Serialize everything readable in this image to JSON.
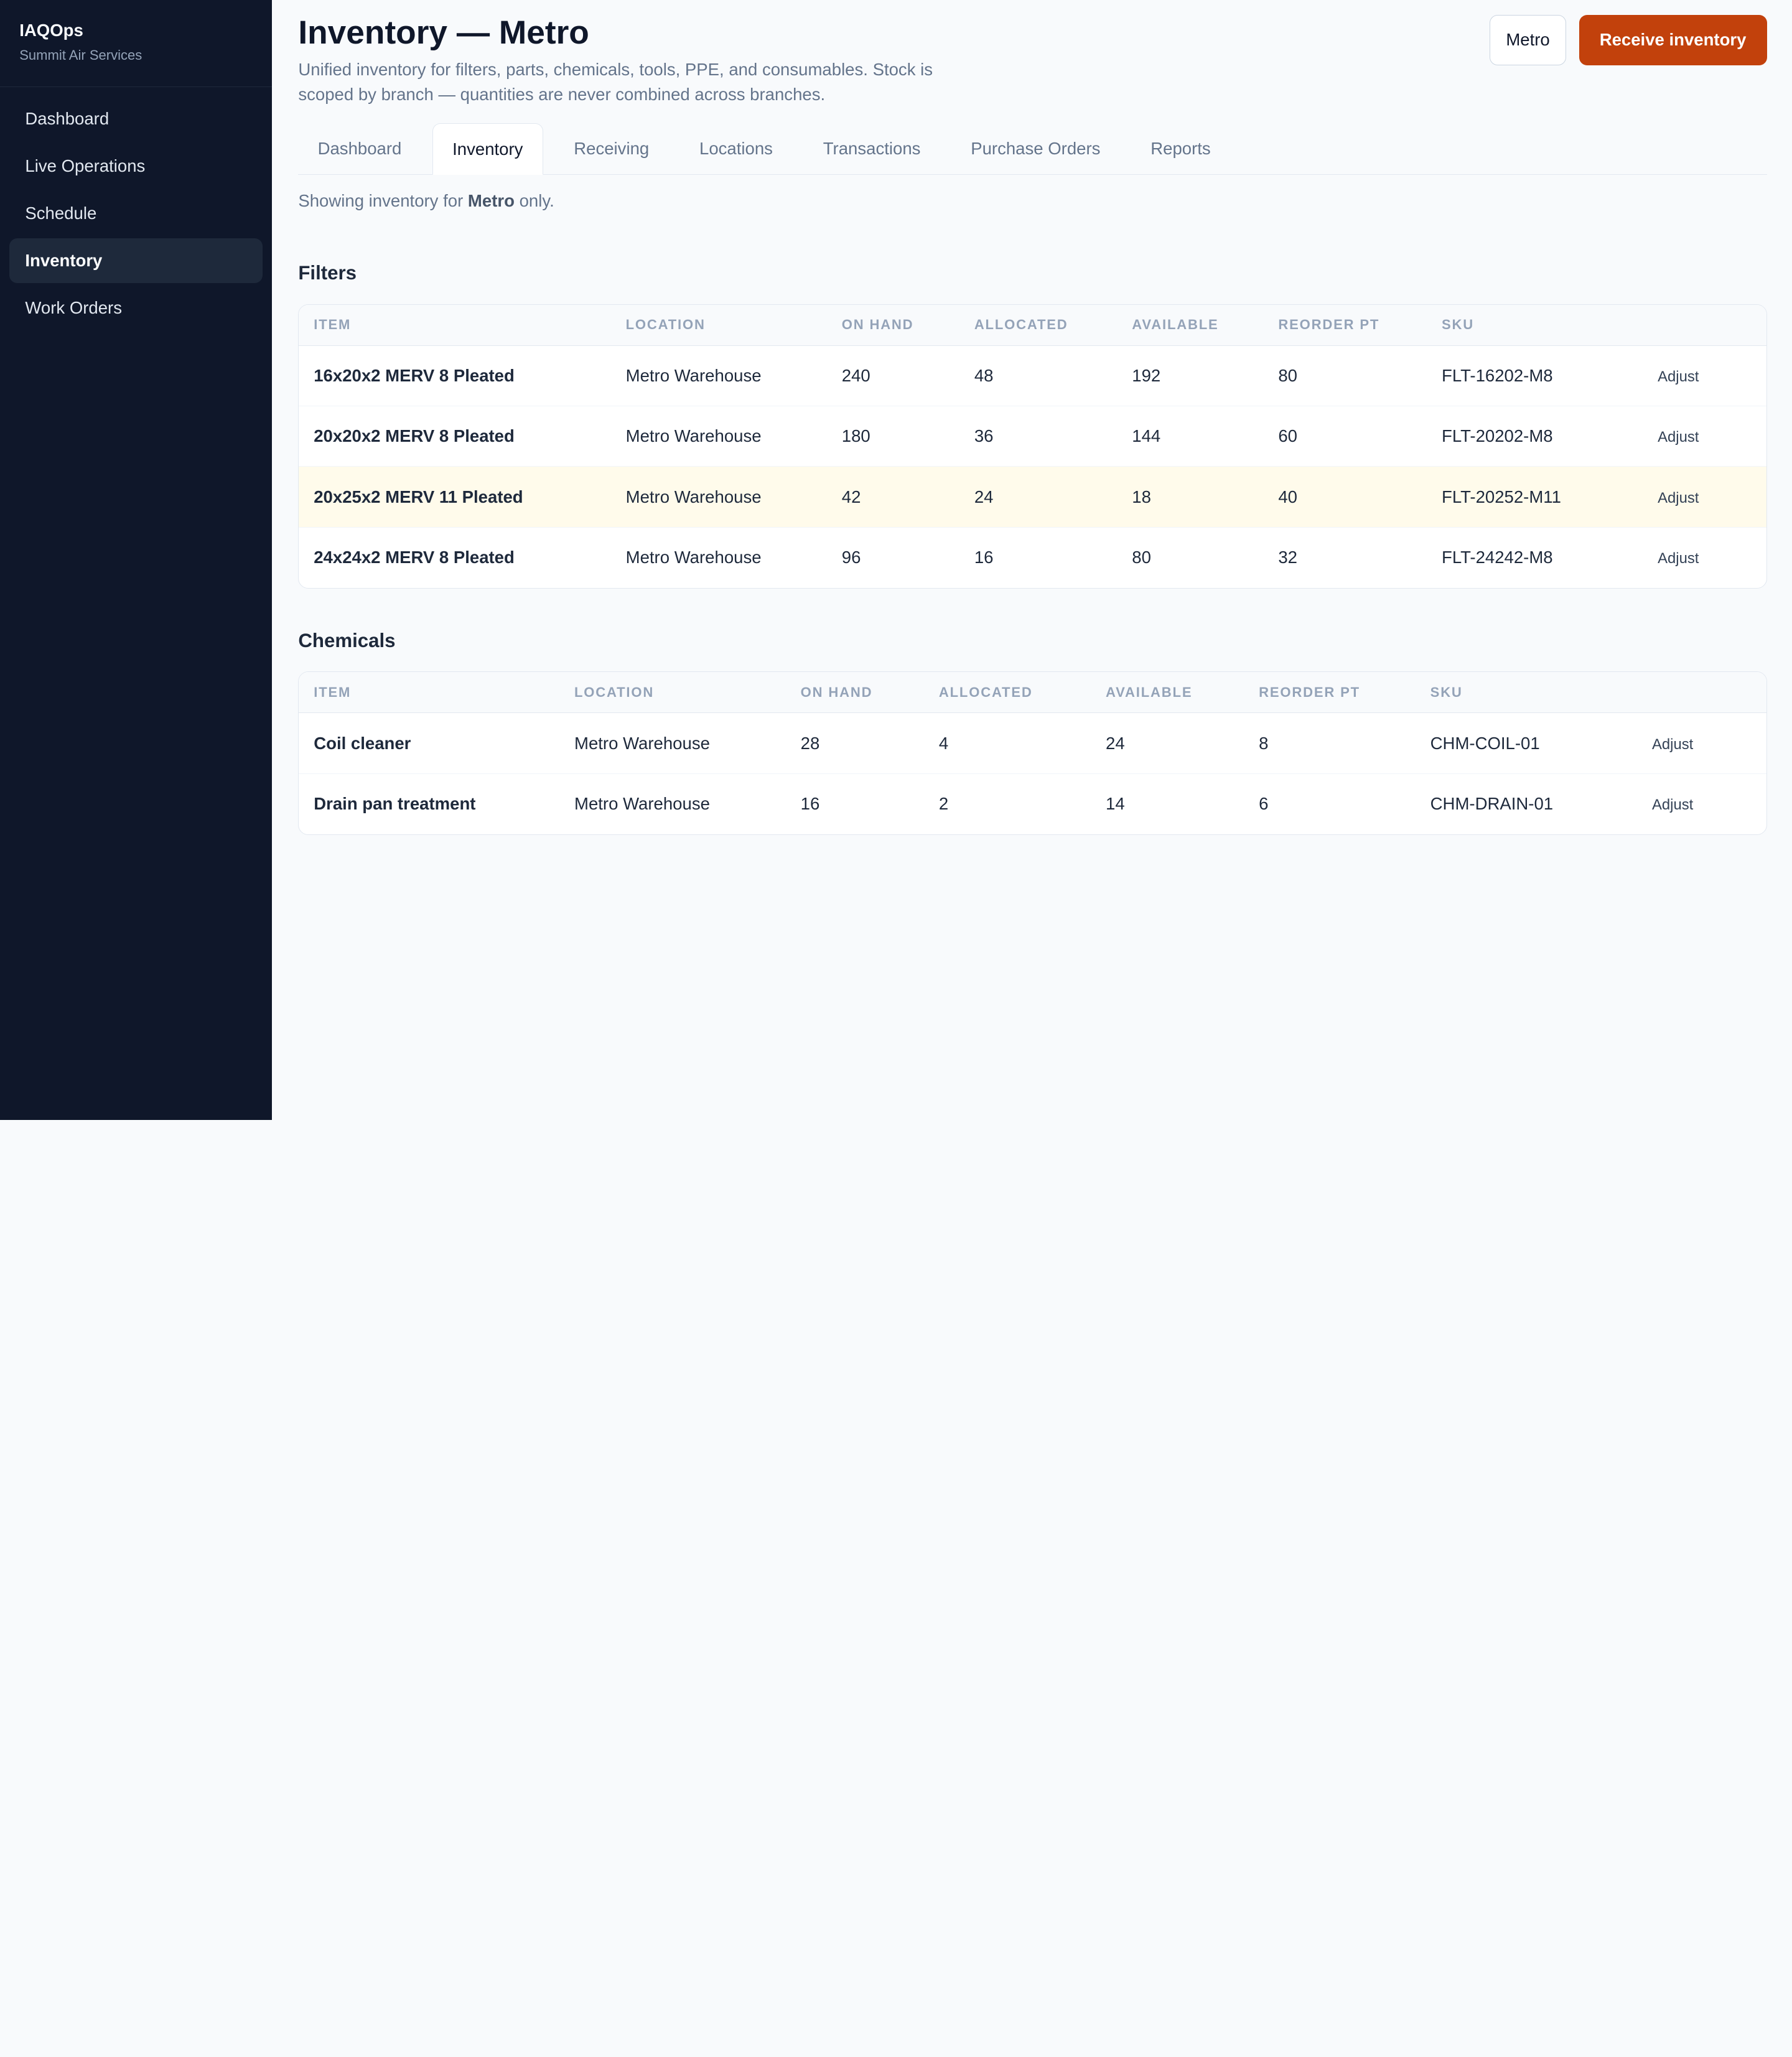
{
  "sidebar": {
    "brand": "IAQOps",
    "org": "Summit Air Services",
    "items": [
      {
        "label": "Dashboard"
      },
      {
        "label": "Live Operations"
      },
      {
        "label": "Schedule"
      },
      {
        "label": "Inventory",
        "active": true
      },
      {
        "label": "Work Orders"
      }
    ]
  },
  "header": {
    "title": "Inventory — Metro",
    "description": "Unified inventory for filters, parts, chemicals, tools, PPE, and consumables. Stock is scoped by branch — quantities are never combined across branches.",
    "branch_button": "Metro",
    "primary_button": "Receive inventory"
  },
  "tabs": [
    {
      "label": "Dashboard"
    },
    {
      "label": "Inventory",
      "active": true
    },
    {
      "label": "Receiving"
    },
    {
      "label": "Locations"
    },
    {
      "label": "Transactions"
    },
    {
      "label": "Purchase Orders"
    },
    {
      "label": "Reports"
    }
  ],
  "scope_note": {
    "prefix": "Showing inventory for ",
    "branch": "Metro",
    "suffix": " only."
  },
  "columns": [
    "Item",
    "Location",
    "On hand",
    "Allocated",
    "Available",
    "Reorder pt",
    "SKU",
    ""
  ],
  "sections": [
    {
      "title": "Filters",
      "rows": [
        {
          "item": "16x20x2 MERV 8 Pleated",
          "location": "Metro Warehouse",
          "on_hand": "240",
          "allocated": "48",
          "available": "192",
          "reorder": "80",
          "sku": "FLT-16202-M8",
          "action": "Adjust"
        },
        {
          "item": "20x20x2 MERV 8 Pleated",
          "location": "Metro Warehouse",
          "on_hand": "180",
          "allocated": "36",
          "available": "144",
          "reorder": "60",
          "sku": "FLT-20202-M8",
          "action": "Adjust"
        },
        {
          "item": "20x25x2 MERV 11 Pleated",
          "location": "Metro Warehouse",
          "on_hand": "42",
          "allocated": "24",
          "available": "18",
          "reorder": "40",
          "sku": "FLT-20252-M11",
          "action": "Adjust",
          "low": true
        },
        {
          "item": "24x24x2 MERV 8 Pleated",
          "location": "Metro Warehouse",
          "on_hand": "96",
          "allocated": "16",
          "available": "80",
          "reorder": "32",
          "sku": "FLT-24242-M8",
          "action": "Adjust"
        }
      ]
    },
    {
      "title": "Chemicals",
      "rows": [
        {
          "item": "Coil cleaner",
          "location": "Metro Warehouse",
          "on_hand": "28",
          "allocated": "4",
          "available": "24",
          "reorder": "8",
          "sku": "CHM-COIL-01",
          "action": "Adjust"
        },
        {
          "item": "Drain pan treatment",
          "location": "Metro Warehouse",
          "on_hand": "16",
          "allocated": "2",
          "available": "14",
          "reorder": "6",
          "sku": "CHM-DRAIN-01",
          "action": "Adjust"
        }
      ]
    }
  ],
  "colors": {
    "sidebar_bg": "#0f172a",
    "accent": "#c2410c",
    "low_stock_row": "#fffbeb"
  }
}
